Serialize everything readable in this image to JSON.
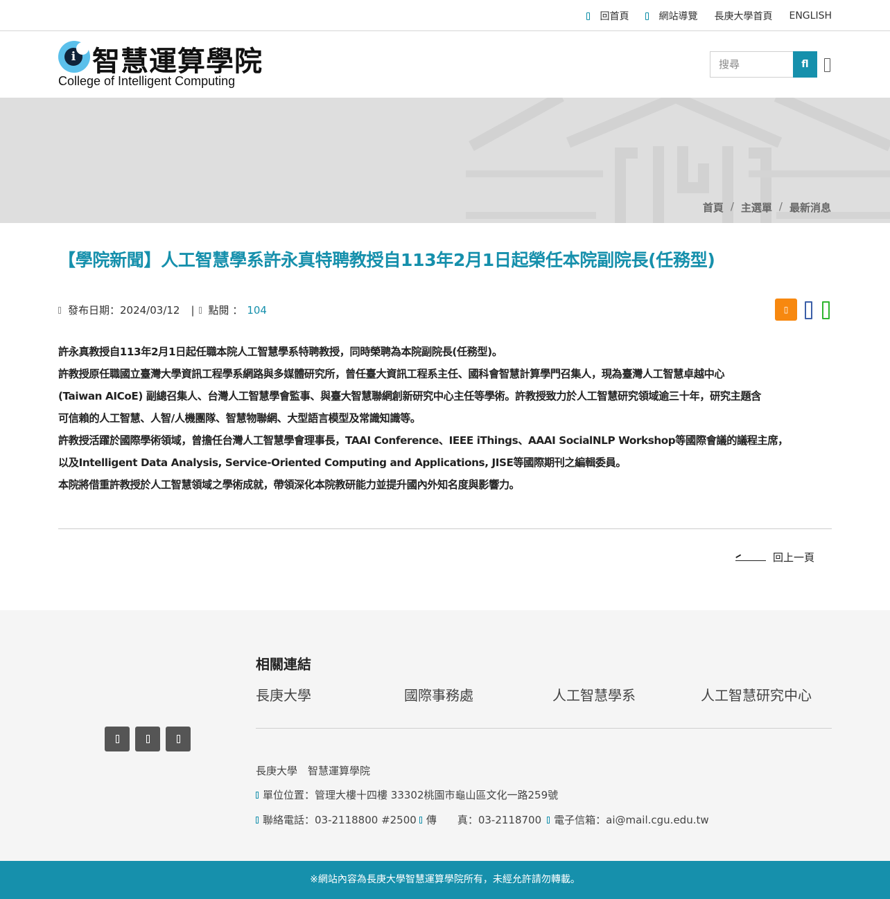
{
  "topbar": {
    "links": [
      "回首頁",
      "網站導覽",
      "長庚大學首頁",
      "ENGLISH"
    ]
  },
  "header": {
    "logo_cn": "智慧運算學院",
    "logo_en": "College of Intelligent Computing",
    "logo_letter": "i",
    "search_placeholder": "搜尋",
    "search_button": "fl"
  },
  "breadcrumb": [
    "首頁",
    "主選單",
    "最新消息"
  ],
  "article": {
    "title": "【學院新聞】人工智慧學系許永真特聘教授自113年2月1日起榮任本院副院長(任務型)",
    "date_label": "發布日期：2024/03/12",
    "views_label": "點閱 ：",
    "views": "104",
    "paragraphs": [
      "許永真教授自113年2月1日起任職本院人工智慧學系特聘教授，同時榮聘為本院副院長(任務型)。",
      "許教授原任職國立臺灣大學資訊工程學系網路與多媒體研究所，曾任臺大資訊工程系主任、國科會智慧計算學門召集人，現為臺灣人工智慧卓越中心",
      "(Taiwan AICoE) 副總召集人、台灣人工智慧學會監事、與臺大智慧聯網創新研究中心主任等學術。許教授致力於人工智慧研究領域逾三十年，研究主題含",
      "可信賴的人工智慧、人智/人機團隊、智慧物聯網、大型語言模型及常識知識等。",
      "許教授活躍於國際學術領域，曾擔任台灣人工智慧學會理事長，TAAI Conference、IEEE iThings、AAAI SocialNLP Workshop等國際會議的議程主席，",
      "以及Intelligent Data Analysis, Service-Oriented Computing and Applications, JISE等國際期刊之編輯委員。",
      "本院將借重許教授於人工智慧領域之學術成就，帶領深化本院教研能力並提升國內外知名度與影響力。"
    ],
    "back_label": "回上一頁"
  },
  "footer": {
    "related_title": "相關連結",
    "related_links": [
      "長庚大學",
      "國際事務處",
      "人工智慧學系",
      "人工智慧研究中心"
    ],
    "org": "長庚大學　智慧運算學院",
    "address": "單位位置：管理大樓十四樓 33302桃園市龜山區文化一路259號",
    "phone": "聯絡電話：03-2118800 #2500",
    "fax": "傳　　真：03-2118700",
    "email": "電子信箱：ai@mail.cgu.edu.tw",
    "copyright": "※網站內容為長庚大學智慧運算學院所有，未經允許請勿轉載。"
  },
  "colors": {
    "accent": "#1690ac",
    "rss": "#f7880f",
    "facebook": "#3b5fa8",
    "line": "#2fb52f",
    "banner": "#dedede",
    "footer_bg": "#f5f5f5"
  }
}
